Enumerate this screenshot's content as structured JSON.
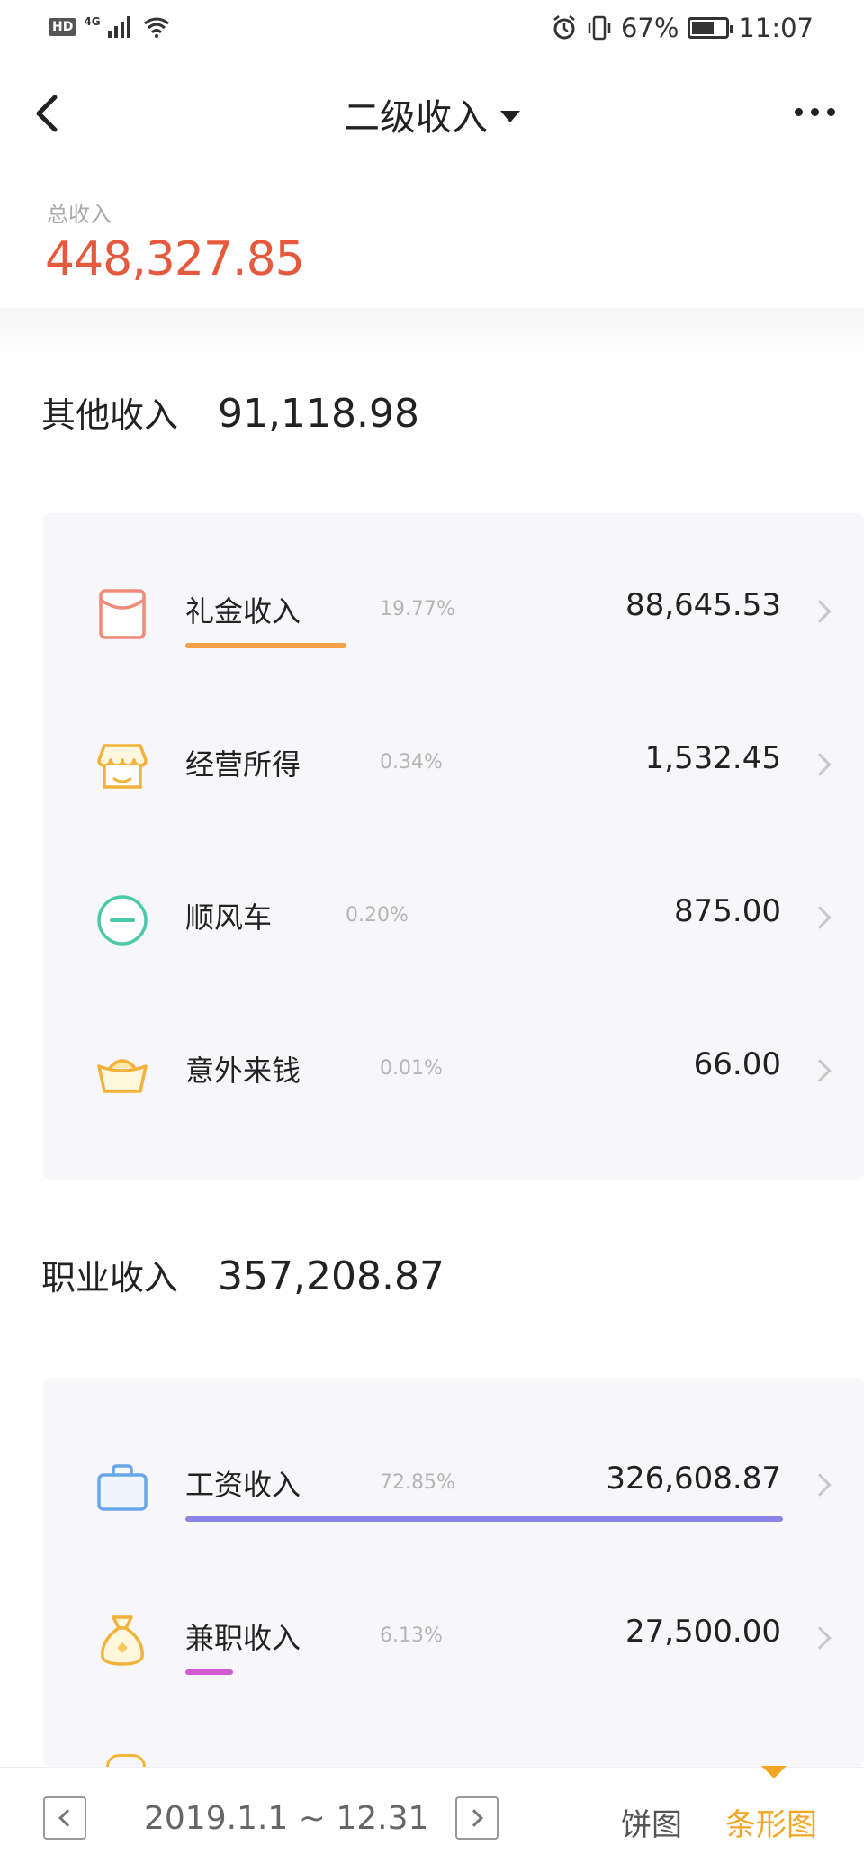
{
  "status_bar": {
    "hd": "HD",
    "network": "4G",
    "battery": "67%",
    "battery_level": 0.67,
    "time": "11:07"
  },
  "header": {
    "title": "二级收入"
  },
  "total": {
    "label": "总收入",
    "value": "448,327.85"
  },
  "groups": [
    {
      "name": "其他收入",
      "total": "91,118.98",
      "items": [
        {
          "name": "礼金收入",
          "pct": "19.77%",
          "amount": "88,645.53",
          "icon": "red-envelope-icon",
          "bar_color": "#f7a04c",
          "bar_fraction": 0.27
        },
        {
          "name": "经营所得",
          "pct": "0.34%",
          "amount": "1,532.45",
          "icon": "shop-icon",
          "bar_color": "#f5b945",
          "bar_fraction": 0
        },
        {
          "name": "顺风车",
          "pct": "0.20%",
          "amount": "875.00",
          "icon": "car-sharing-icon",
          "bar_color": "#4cc9a9",
          "bar_fraction": 0
        },
        {
          "name": "意外来钱",
          "pct": "0.01%",
          "amount": "66.00",
          "icon": "gold-ingot-icon",
          "bar_color": "#f5c13b",
          "bar_fraction": 0
        }
      ]
    },
    {
      "name": "职业收入",
      "total": "357,208.87",
      "items": [
        {
          "name": "工资收入",
          "pct": "72.85%",
          "amount": "326,608.87",
          "icon": "wallet-bag-icon",
          "bar_color": "#8c85e6",
          "bar_fraction": 1.0
        },
        {
          "name": "兼职收入",
          "pct": "6.13%",
          "amount": "27,500.00",
          "icon": "money-bag-icon",
          "bar_color": "#d35bd3",
          "bar_fraction": 0.08
        }
      ]
    }
  ],
  "footer": {
    "date_range": "2019.1.1 ~ 12.31",
    "view_pie": "饼图",
    "view_bar": "条形图",
    "active_view": "条形图"
  },
  "colors": {
    "accent": "#f2a623",
    "total_value": "#e55a3d",
    "card_bg": "#f7f7fa"
  }
}
